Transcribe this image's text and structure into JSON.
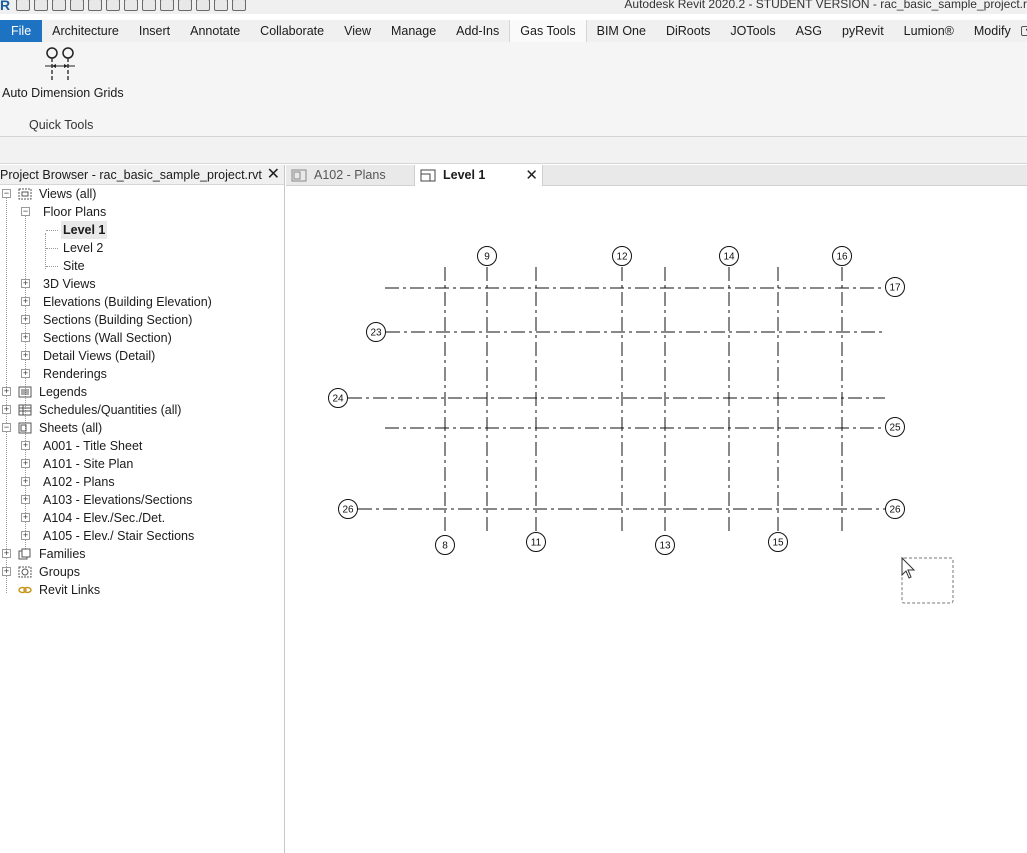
{
  "app_title": "Autodesk Revit 2020.2 - STUDENT VERSION - rac_basic_sample_project.r",
  "ribbon": {
    "tabs": [
      {
        "label": "File",
        "kind": "file"
      },
      {
        "label": "Architecture"
      },
      {
        "label": "Insert"
      },
      {
        "label": "Annotate"
      },
      {
        "label": "Collaborate"
      },
      {
        "label": "View"
      },
      {
        "label": "Manage"
      },
      {
        "label": "Add-Ins"
      },
      {
        "label": "Gas Tools",
        "active": true
      },
      {
        "label": "BIM One"
      },
      {
        "label": "DiRoots"
      },
      {
        "label": "JOTools"
      },
      {
        "label": "ASG"
      },
      {
        "label": "pyRevit"
      },
      {
        "label": "Lumion®"
      },
      {
        "label": "Modify"
      }
    ],
    "tool_button_label": "Auto Dimension Grids",
    "panel_label": "Quick Tools"
  },
  "project_browser": {
    "title": "Project Browser - rac_basic_sample_project.rvt",
    "close_glyph": "✕",
    "views_all": "Views (all)",
    "floor_plans": "Floor Plans",
    "level1": "Level 1",
    "level2": "Level 2",
    "site": "Site",
    "views_3d": "3D Views",
    "elevations": "Elevations (Building Elevation)",
    "sections_building": "Sections (Building Section)",
    "sections_wall": "Sections (Wall Section)",
    "detail_views": "Detail Views (Detail)",
    "renderings": "Renderings",
    "legends": "Legends",
    "schedules": "Schedules/Quantities (all)",
    "sheets": "Sheets (all)",
    "sheet_a001": "A001 - Title Sheet",
    "sheet_a101": "A101 - Site Plan",
    "sheet_a102": "A102 - Plans",
    "sheet_a103": "A103 - Elevations/Sections",
    "sheet_a104": "A104 - Elev./Sec./Det.",
    "sheet_a105": "A105 - Elev./ Stair Sections",
    "families": "Families",
    "groups": "Groups",
    "revit_links": "Revit Links"
  },
  "view_tabs": {
    "tab1": "A102 - Plans",
    "tab2": "Level 1",
    "close_glyph": "✕"
  },
  "grids": {
    "vertical": [
      "8",
      "9",
      "11",
      "12",
      "13",
      "14",
      "15",
      "16"
    ],
    "horizontal": [
      "17",
      "23",
      "24",
      "25",
      "26"
    ]
  }
}
